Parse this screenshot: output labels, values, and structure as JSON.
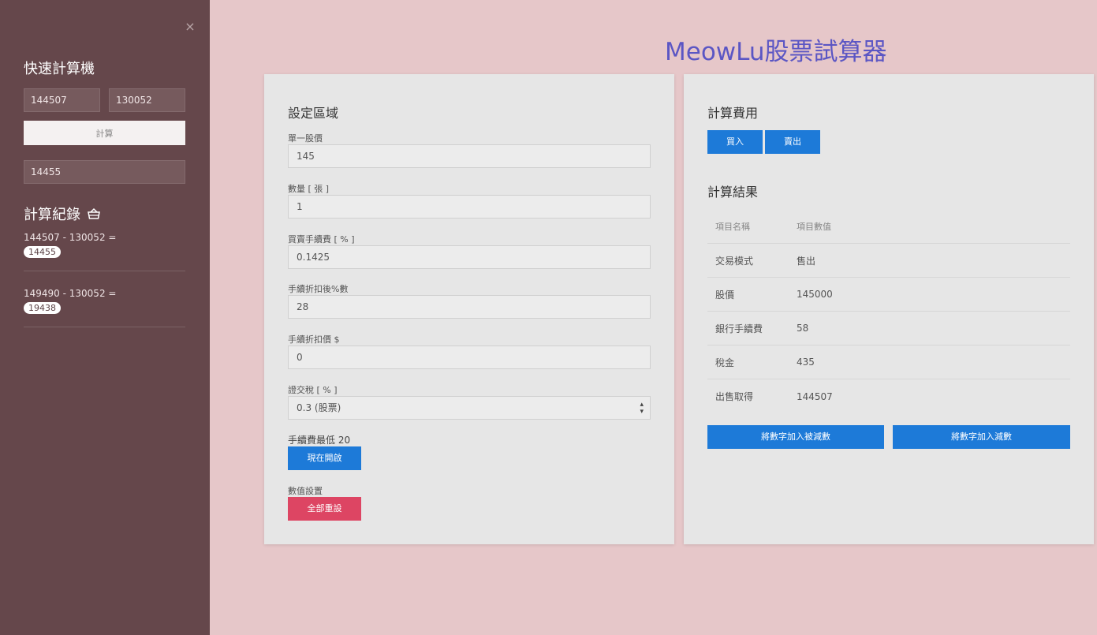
{
  "sidebar": {
    "close_glyph": "×",
    "title": "快速計算機",
    "input_a": "144507",
    "input_b": "130052",
    "calc_label": "計算",
    "result": "14455",
    "history_title": "計算紀錄",
    "history": [
      {
        "expr": "144507 - 130052 =",
        "result": "14455"
      },
      {
        "expr": "149490 - 130052 =",
        "result": "19438"
      }
    ]
  },
  "page": {
    "title": "MeowLu股票試算器"
  },
  "settings": {
    "title": "設定區域",
    "unit_price_label": "單一股價",
    "unit_price": "145",
    "quantity_label": "數量 [ 張 ]",
    "quantity": "1",
    "fee_label": "買賣手續費 [ % ]",
    "fee": "0.1425",
    "discount_pct_label": "手續折扣後%數",
    "discount_pct": "28",
    "discount_amount_label": "手續折扣價 $",
    "discount_amount": "0",
    "tax_label": "證交稅 [ % ]",
    "tax_selected": "0.3 (股票)",
    "min_fee_label": "手續費最低 20",
    "min_fee_button": "現在開啟",
    "reset_section_label": "數值設置",
    "reset_button": "全部重設"
  },
  "calc": {
    "title": "計算費用",
    "buy_label": "買入",
    "sell_label": "賣出",
    "result_title": "計算結果",
    "table_headers": [
      "項目名稱",
      "項目數值"
    ],
    "rows": [
      [
        "交易模式",
        "售出"
      ],
      [
        "股價",
        "145000"
      ],
      [
        "銀行手續費",
        "58"
      ],
      [
        "稅金",
        "435"
      ],
      [
        "出售取得",
        "144507"
      ]
    ],
    "add_to_minuend": "將數字加入被減數",
    "add_to_subtrahend": "將數字加入減數"
  }
}
